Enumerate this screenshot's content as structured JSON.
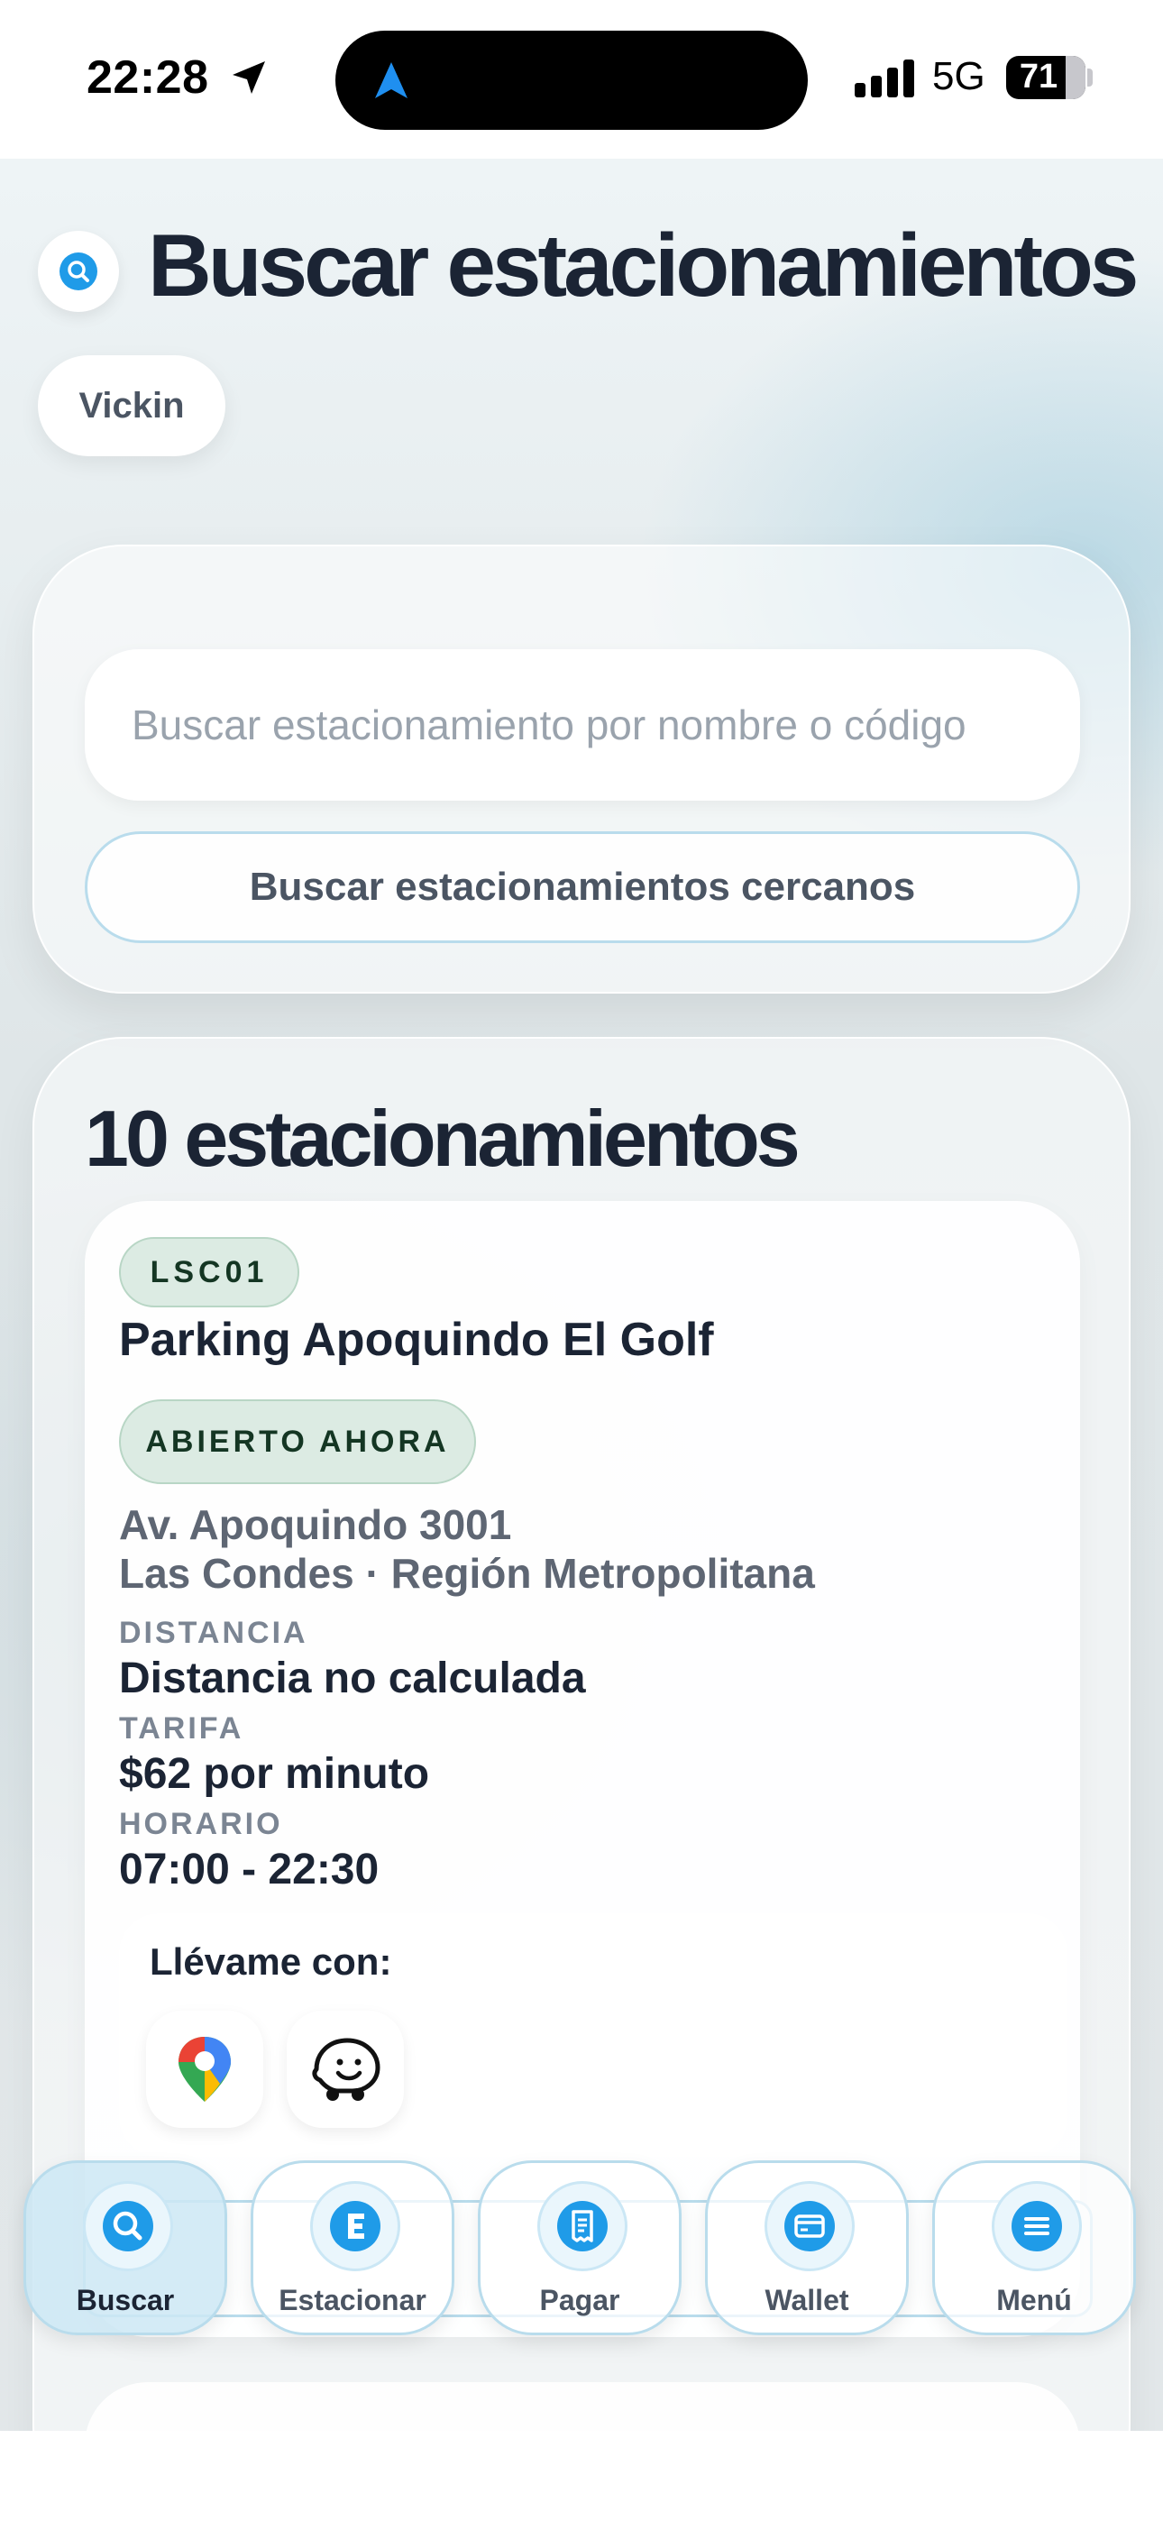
{
  "status_bar": {
    "time": "22:28",
    "network": "5G",
    "battery": "71"
  },
  "header": {
    "title": "Buscar estacionamientos",
    "user": "Vickin",
    "icon": "search-icon"
  },
  "search": {
    "placeholder": "Buscar estacionamiento por nombre o código",
    "value": "",
    "nearby_button": "Buscar estacionamientos cercanos"
  },
  "results": {
    "title": "10 estacionamientos",
    "items": [
      {
        "code": "LSC01",
        "name": "Parking Apoquindo El Golf",
        "status": "ABIERTO AHORA",
        "address_line1": "Av. Apoquindo 3001",
        "address_line2": "Las Condes · Región Metropolitana",
        "distance_label": "DISTANCIA",
        "distance": "Distancia no calculada",
        "rate_label": "TARIFA",
        "rate": "$62 por minuto",
        "hours_label": "HORARIO",
        "hours": "07:00 - 22:30",
        "navigate_label": "Llévame con:",
        "nav_apps": [
          "google-maps-icon",
          "waze-icon"
        ]
      }
    ]
  },
  "tabbar": {
    "tabs": [
      {
        "label": "Buscar",
        "icon": "search-icon",
        "active": true
      },
      {
        "label": "Estacionar",
        "icon": "letter-e-icon",
        "active": false
      },
      {
        "label": "Pagar",
        "icon": "receipt-icon",
        "active": false
      },
      {
        "label": "Wallet",
        "icon": "card-icon",
        "active": false
      },
      {
        "label": "Menú",
        "icon": "menu-icon",
        "active": false
      }
    ]
  },
  "colors": {
    "accent": "#1f9be8",
    "badge_green_bg": "#dcebe3",
    "badge_green_text": "#143623",
    "title_text": "#1b2434"
  }
}
